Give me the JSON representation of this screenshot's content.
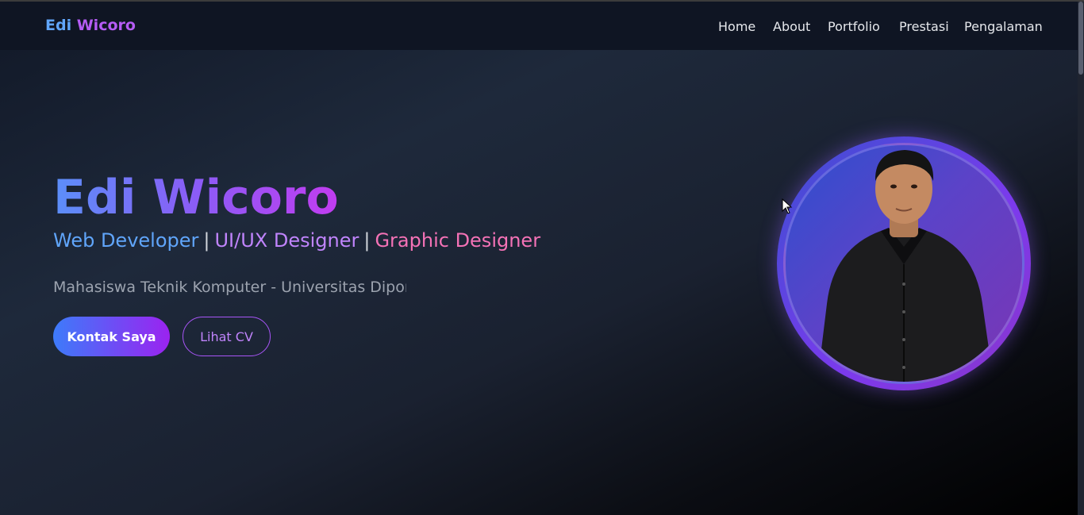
{
  "navbar": {
    "brand_first": "Edi",
    "brand_last": "Wicoro",
    "links": [
      "Home",
      "About",
      "Portfolio",
      "Prestasi",
      "Pengalaman"
    ]
  },
  "hero": {
    "name": "Edi Wicoro",
    "roles": [
      "Web Developer",
      "UI/UX Designer",
      "Graphic Designer"
    ],
    "separator": "|",
    "tagline": "Mahasiswa Teknik Komputer - Universitas Diponegoro",
    "primary_button": "Kontak Saya",
    "secondary_button": "Lihat CV"
  },
  "colors": {
    "background": "#1e293b",
    "accent_blue": "#60a5fa",
    "accent_purple": "#c084fc",
    "accent_pink": "#f472b6"
  },
  "icons": {
    "profile_photo": "person-portrait-icon",
    "cursor": "mouse-pointer-icon"
  }
}
